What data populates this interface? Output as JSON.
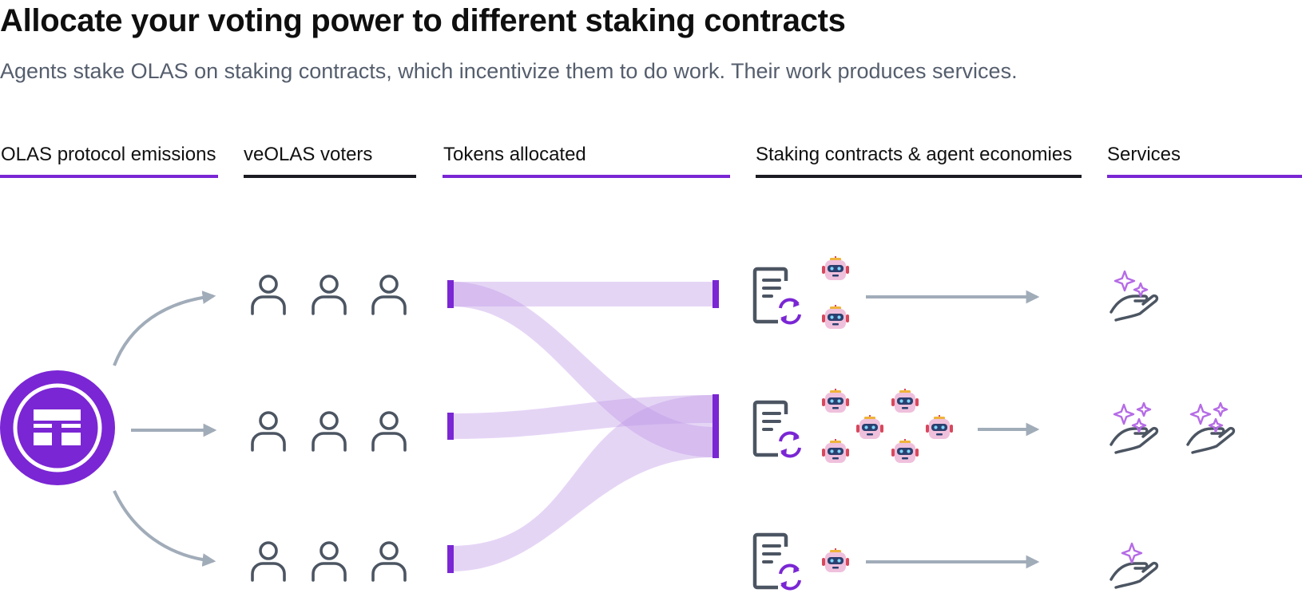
{
  "header": {
    "title": "Allocate your voting power to different staking contracts",
    "subtitle": "Agents stake OLAS on staking contracts, which incentivize them to do work. Their work produces services."
  },
  "columns": [
    {
      "label": "OLAS protocol emissions"
    },
    {
      "label": "veOLAS voters"
    },
    {
      "label": "Tokens allocated"
    },
    {
      "label": "Staking contracts & agent economies"
    },
    {
      "label": "Services"
    }
  ],
  "colors": {
    "accent": "#7a26d4",
    "flow": "#c19ae8",
    "divider_dark": "#1b1b22",
    "icon": "#4c5562",
    "arrow": "#a1acb9",
    "sparkle": "#b56be6",
    "robot_face": "#efc0dc",
    "robot_visor": "#2b3f6e",
    "robot_eye": "#7fd6ff",
    "robot_antenna": "#f0b33a",
    "robot_ears": "#d8485c"
  },
  "icons": {
    "emission": "olas-logo-icon",
    "voter": "person-icon",
    "contract": "staking-contract-icon",
    "agent": "robot-agent-icon",
    "service": "hand-sparkles-icon"
  },
  "rows": [
    {
      "voter_count": 3,
      "agent_count": 2,
      "service_count": 1,
      "service_sparkles": 2
    },
    {
      "voter_count": 3,
      "agent_count": 6,
      "service_count": 2,
      "service_sparkles": 3
    },
    {
      "voter_count": 3,
      "agent_count": 1,
      "service_count": 1,
      "service_sparkles": 1
    }
  ]
}
